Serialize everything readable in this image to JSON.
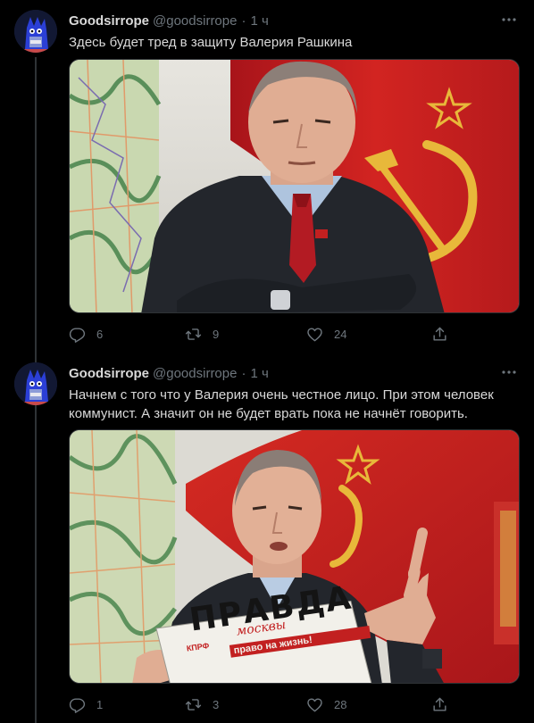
{
  "tweets": [
    {
      "author": {
        "display_name": "Goodsirrope",
        "handle": "@goodsirrope"
      },
      "time": "1 ч",
      "separator": "·",
      "text": "Здесь будет тред в защиту Валерия Рашкина",
      "media": {
        "alt": ""
      },
      "stats": {
        "replies": "6",
        "retweets": "9",
        "likes": "24"
      }
    },
    {
      "author": {
        "display_name": "Goodsirrope",
        "handle": "@goodsirrope"
      },
      "time": "1 ч",
      "separator": "·",
      "text": "Начнем с того что у Валерия очень честное лицо. При этом человек коммунист. А значит он не будет врать пока не начнёт говорить.",
      "media": {
        "newspaper_title": "ПРАВДА",
        "newspaper_subtitle": "москвы",
        "newspaper_tagline": "право на жизнь!",
        "newspaper_badge": "КПРФ"
      },
      "stats": {
        "replies": "1",
        "retweets": "3",
        "likes": "28"
      }
    }
  ],
  "colors": {
    "background": "#000000",
    "text": "#d9d9d9",
    "muted": "#6e767d",
    "border": "#2f3336",
    "flag_red": "#c8201f",
    "emblem_gold": "#e8b83a"
  },
  "icons": [
    "more-icon",
    "reply-icon",
    "retweet-icon",
    "like-icon",
    "share-icon"
  ]
}
